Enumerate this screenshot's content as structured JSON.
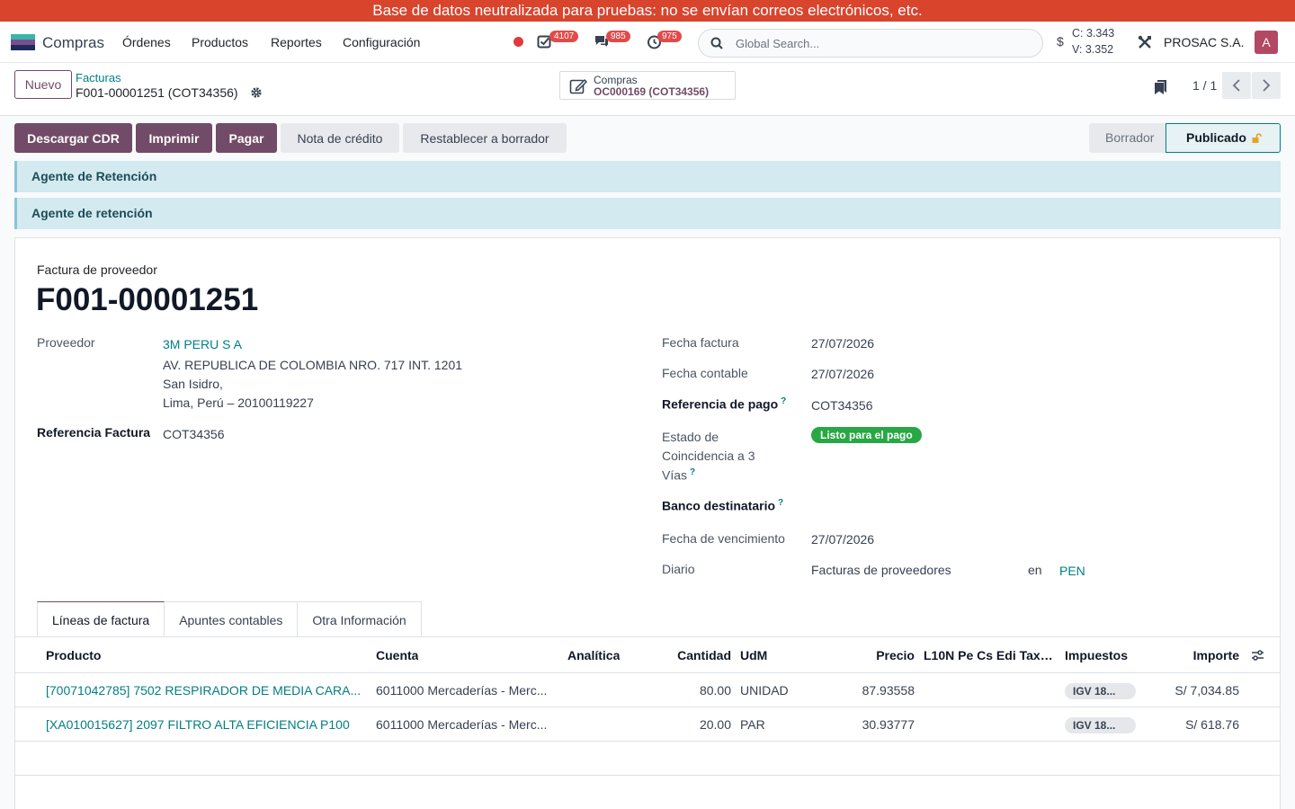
{
  "banner": "Base de datos neutralizada para pruebas: no se envían correos electrónicos, etc.",
  "navbar": {
    "app_name": "Compras",
    "menus": [
      "Órdenes",
      "Productos",
      "Reportes",
      "Configuración"
    ],
    "badges": {
      "activities": "4107",
      "messages": "985",
      "timesheets": "975"
    },
    "search_placeholder": "Global Search...",
    "currency_sign": "$",
    "rate_buy": "C: 3.343",
    "rate_sell": "V: 3.352",
    "company": "PROSAC S.A.",
    "avatar_letter": "A"
  },
  "control": {
    "new_label": "Nuevo",
    "breadcrumb_parent": "Facturas",
    "breadcrumb_current": "F001-00001251 (COT34356)",
    "smart_button_title": "Compras",
    "smart_button_value": "OC000169 (COT34356)",
    "pager": "1 / 1"
  },
  "statusbar": {
    "buttons": [
      "Descargar CDR",
      "Imprimir",
      "Pagar",
      "Nota de crédito",
      "Restablecer a borrador"
    ],
    "stages": [
      "Borrador",
      "Publicado"
    ]
  },
  "alerts": [
    "Agente de Retención",
    "Agente de retención"
  ],
  "form": {
    "doc_type": "Factura de proveedor",
    "doc_name": "F001-00001251",
    "vendor_label": "Proveedor",
    "vendor_name": "3M PERU S A",
    "vendor_address_1": "AV. REPUBLICA DE COLOMBIA NRO. 717 INT. 1201",
    "vendor_address_2": "San Isidro,",
    "vendor_address_3": "Lima, Perú – 20100119227",
    "ref_label": "Referencia Factura",
    "ref_value": "COT34356",
    "invoice_date_label": "Fecha factura",
    "invoice_date": "27/07/2026",
    "accounting_date_label": "Fecha contable",
    "accounting_date": "27/07/2026",
    "payment_ref_label": "Referencia de pago",
    "payment_ref": "COT34356",
    "match_label_1": "Estado de",
    "match_label_2": "Coincidencia a 3",
    "match_label_3": "Vías",
    "match_status": "Listo para el pago",
    "bank_label": "Banco destinatario",
    "due_date_label": "Fecha de vencimiento",
    "due_date": "27/07/2026",
    "journal_label": "Diario",
    "journal": "Facturas de proveedores",
    "journal_in": "en",
    "currency": "PEN",
    "help_mark": "?"
  },
  "tabs": [
    "Líneas de factura",
    "Apuntes contables",
    "Otra Información"
  ],
  "lines": {
    "headers": {
      "product": "Producto",
      "account": "Cuenta",
      "analytic": "Analítica",
      "quantity": "Cantidad",
      "uom": "UdM",
      "price": "Precio",
      "edi": "L10N Pe Cs Edi Tax ...",
      "taxes": "Impuestos",
      "amount": "Importe"
    },
    "rows": [
      {
        "product": "[70071042785] 7502 RESPIRADOR DE MEDIA CARA...",
        "account": "6011000 Mercaderías - Merc...",
        "quantity": "80.00",
        "uom": "UNIDAD",
        "price": "87.93558",
        "tax": "IGV 18...",
        "amount": "S/ 7,034.85"
      },
      {
        "product": "[XA010015627] 2097 FILTRO ALTA EFICIENCIA P100",
        "account": "6011000 Mercaderías - Merc...",
        "quantity": "20.00",
        "uom": "PAR",
        "price": "30.93777",
        "tax": "IGV 18...",
        "amount": "S/ 618.76"
      }
    ]
  }
}
